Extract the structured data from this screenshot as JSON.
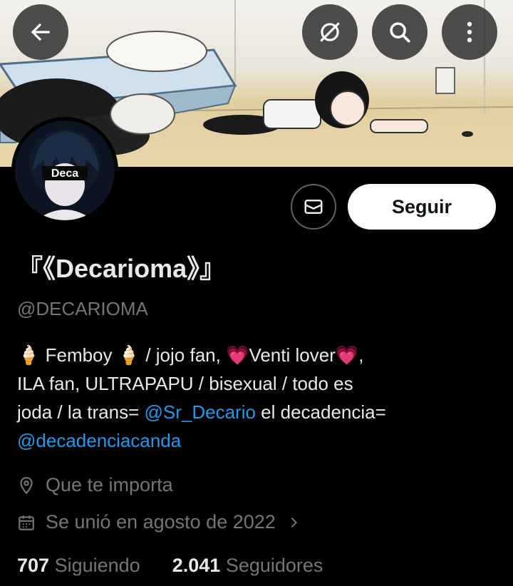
{
  "toolbar": {
    "back_icon": "arrow-left-icon",
    "hide_icon": "eye-slash-icon",
    "search_icon": "search-icon",
    "more_icon": "more-vertical-icon"
  },
  "avatar": {
    "text": "Deca"
  },
  "actions": {
    "message_icon": "envelope-icon",
    "follow_label": "Seguir"
  },
  "profile": {
    "display_name": "『《Decarioma》』",
    "handle": "@DECARIOMA",
    "bio": {
      "line1": "🍦 Femboy 🍦 / jojo fan, 💗Venti lover💗,",
      "line2": "ILA fan, ULTRAPAPU / bisexual / todo es",
      "line3_prefix": "joda / la trans= ",
      "mention1": "@Sr_Decario",
      "line3_suffix": " el decadencia=",
      "mention2": "@decadenciacanda"
    },
    "location": "Que te importa",
    "joined": "Se unió en agosto de 2022",
    "following_count": "707",
    "following_label": "Siguiendo",
    "followers_count": "2.041",
    "followers_label": "Seguidores"
  },
  "colors": {
    "accent": "#1d9bf0",
    "muted": "#71767b",
    "background": "#000000"
  }
}
